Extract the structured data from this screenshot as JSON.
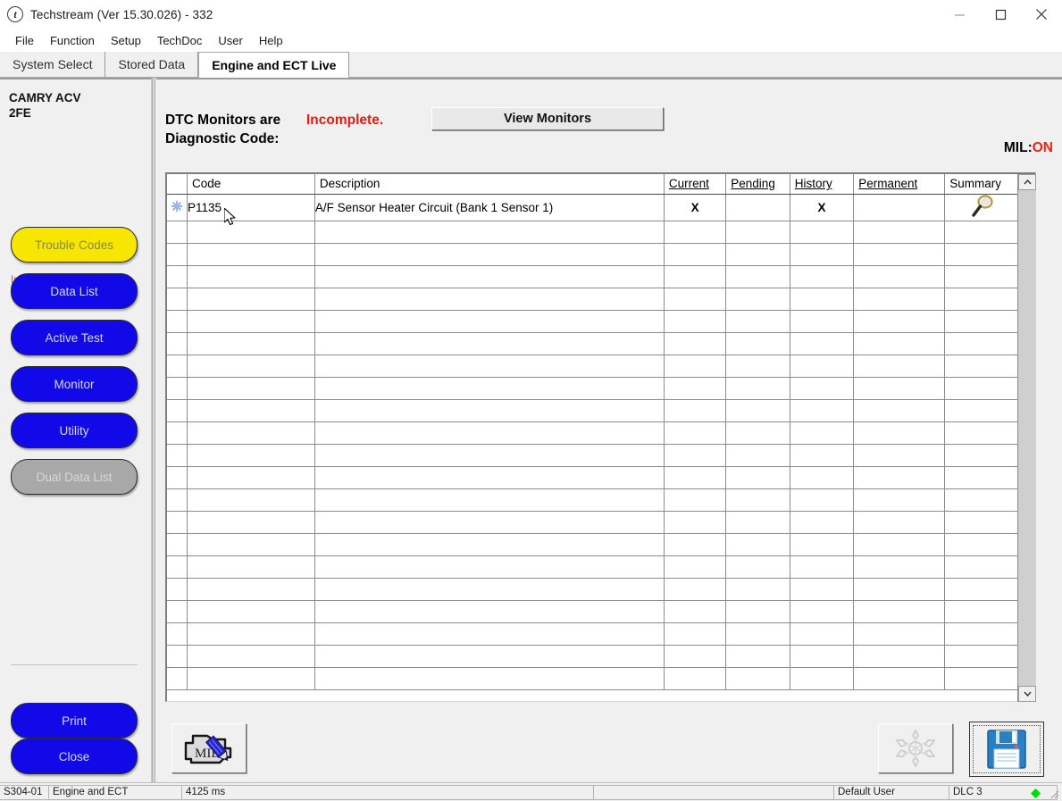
{
  "window": {
    "title": "Techstream (Ver 15.30.026) - 332",
    "icon": "techstream-logo-icon",
    "controls": {
      "minimize": "minimize-icon",
      "maximize": "maximize-icon",
      "close": "close-icon"
    }
  },
  "menu": {
    "items": [
      "File",
      "Function",
      "Setup",
      "TechDoc",
      "User",
      "Help"
    ]
  },
  "tabs": [
    {
      "label": "System Select",
      "active": false
    },
    {
      "label": "Stored Data",
      "active": false
    },
    {
      "label": "Engine and ECT Live",
      "active": true
    }
  ],
  "sidebar": {
    "vehicle_line1": "CAMRY ACV",
    "vehicle_line2": "2FE",
    "input_vin_label": "Input VIN",
    "buttons": [
      {
        "label": "Trouble Codes",
        "style": "yellow"
      },
      {
        "label": "Data List",
        "style": "blue"
      },
      {
        "label": "Active Test",
        "style": "blue"
      },
      {
        "label": "Monitor",
        "style": "blue"
      },
      {
        "label": "Utility",
        "style": "blue"
      },
      {
        "label": "Dual Data List",
        "style": "grey"
      }
    ],
    "bottom_buttons": [
      {
        "label": "Print",
        "style": "blue"
      },
      {
        "label": "Close",
        "style": "blue"
      }
    ]
  },
  "header": {
    "dtc_monitors_label": "DTC Monitors are",
    "dtc_monitors_status": "Incomplete.",
    "diagnostic_code_label": "Diagnostic Code:",
    "view_monitors_label": "View Monitors",
    "mil_label": "MIL:",
    "mil_value": "ON"
  },
  "table": {
    "columns": [
      {
        "label": "",
        "key": "icon",
        "link": false
      },
      {
        "label": "Code",
        "key": "code",
        "link": false
      },
      {
        "label": "Description",
        "key": "description",
        "link": false
      },
      {
        "label": "Current",
        "key": "current",
        "link": true
      },
      {
        "label": "Pending",
        "key": "pending",
        "link": true
      },
      {
        "label": "History",
        "key": "history",
        "link": true
      },
      {
        "label": "Permanent",
        "key": "permanent",
        "link": true
      },
      {
        "label": "Summary",
        "key": "summary",
        "link": false
      }
    ],
    "rows": [
      {
        "icon": "freeze-frame-snowflake-icon",
        "code": "P1135",
        "description": "A/F Sensor Heater Circuit (Bank 1 Sensor 1)",
        "current": "X",
        "pending": "",
        "history": "X",
        "permanent": "",
        "summary": "magnifier-icon"
      }
    ],
    "empty_row_count": 21,
    "scrollbar": {
      "up": "chevron-up-icon",
      "down": "chevron-down-icon"
    }
  },
  "toolbar": {
    "clear_dtc": {
      "name": "clear-dtc-engine-icon",
      "label": "MIL"
    },
    "freeze_frame": {
      "name": "freeze-frame-snowflake-icon",
      "enabled": false
    },
    "save": {
      "name": "save-floppy-icon",
      "enabled": true
    }
  },
  "statusbar": {
    "screen_id": "S304-01",
    "system": "Engine and ECT",
    "timing": "4125 ms",
    "progress": "",
    "user": "Default User",
    "connection": "DLC 3",
    "indicator_color": "#00dd00"
  },
  "colors": {
    "accent_blue": "#1209e8",
    "alert_red": "#e01b11",
    "link_blue": "#1414c8",
    "highlight_yellow": "#f7e600"
  }
}
